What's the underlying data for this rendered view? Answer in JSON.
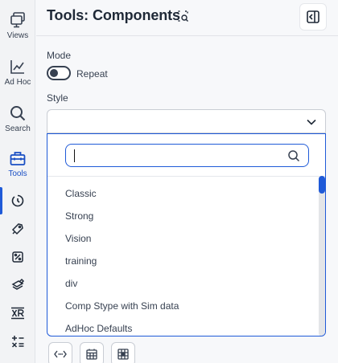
{
  "rail": {
    "items": [
      {
        "label": "Views",
        "icon": "monitor-stack-icon"
      },
      {
        "label": "Ad Hoc",
        "icon": "line-chart-icon"
      },
      {
        "label": "Search",
        "icon": "search-icon"
      },
      {
        "label": "Tools",
        "icon": "toolbox-icon"
      }
    ],
    "sub_icons": [
      "timer-icon",
      "edit-tag-icon",
      "component-icon",
      "stack-edit-icon",
      "xr-icon",
      "calculator-icon"
    ]
  },
  "header": {
    "title": "Tools: Components",
    "title_icon": "select-inspect-icon",
    "collapse_icon": "panel-collapse-icon"
  },
  "mode": {
    "label": "Mode",
    "toggle_label": "Repeat"
  },
  "style": {
    "label": "Style",
    "value": "",
    "search_value": "",
    "options": [
      "Classic",
      "Strong",
      "Vision",
      "training",
      "div",
      "Comp Stype with Sim data",
      "AdHoc Defaults"
    ]
  },
  "bottom_buttons": [
    "code-arrows-icon",
    "grid-table-icon",
    "grid-select-icon"
  ],
  "colors": {
    "accent": "#1f5ad8",
    "rail_bg": "#f2f3f5",
    "panel_bg": "#f7f8fa"
  }
}
